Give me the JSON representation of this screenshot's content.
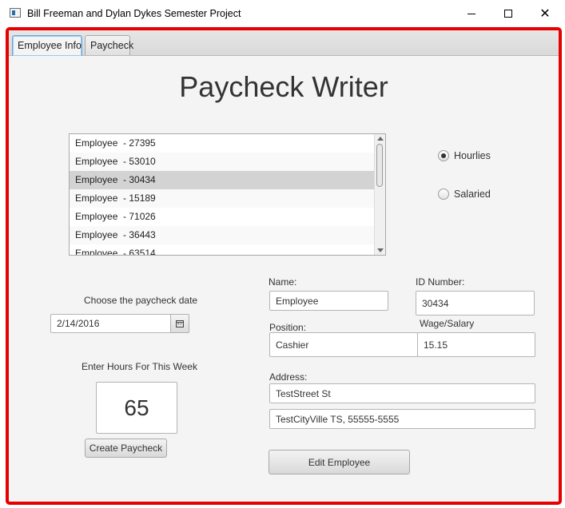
{
  "window": {
    "title": "Bill Freeman and Dylan Dykes Semester Project",
    "minimize_icon": "minimize-icon",
    "maximize_icon": "maximize-icon",
    "close_glyph": "✕"
  },
  "tabs": [
    {
      "label": "Employee Info",
      "active": true
    },
    {
      "label": "Paycheck",
      "active": false
    }
  ],
  "main": {
    "heading": "Paycheck Writer"
  },
  "employee_list": {
    "items": [
      "Employee  - 27395",
      "Employee  - 53010",
      "Employee  - 30434",
      "Employee  - 15189",
      "Employee  - 71026",
      "Employee  - 36443",
      "Employee  - 63514"
    ],
    "selected_index": 2
  },
  "pay_type": {
    "options": [
      "Hourlies",
      "Salaried"
    ],
    "selected": "Hourlies"
  },
  "paycheck": {
    "date_label": "Choose the paycheck date",
    "date_value": "2/14/2016",
    "hours_label": "Enter Hours For This Week",
    "hours_value": "65",
    "create_button": "Create Paycheck"
  },
  "employee": {
    "name_label": "Name:",
    "name_value": "Employee",
    "id_label": "ID Number:",
    "id_value": "30434",
    "position_label": "Position:",
    "position_value": "Cashier",
    "wage_label": "Wage/Salary",
    "wage_value": "15.15",
    "address_label": "Address:",
    "address_line1": "TestStreet St",
    "address_line2": "TestCityVille TS, 55555-5555",
    "edit_button": "Edit Employee"
  },
  "colors": {
    "highlight_border": "#e60000",
    "selected_row": "#d3d3d3",
    "tab_focus": "#6aa7d8"
  }
}
